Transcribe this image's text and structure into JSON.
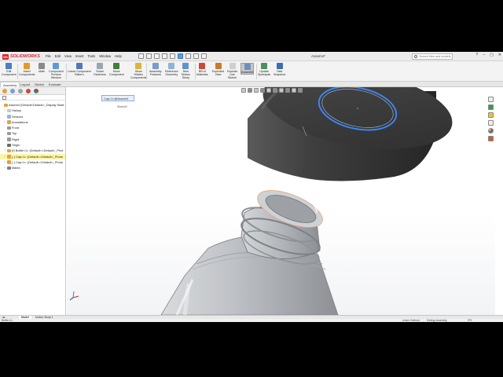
{
  "app": {
    "brand": "SOLIDWORKS",
    "menus": [
      "File",
      "Edit",
      "View",
      "Insert",
      "Tools",
      "Window",
      "Help"
    ],
    "document_title": "Assem4*",
    "search_placeholder": "Search files and models",
    "window_controls": [
      "?",
      "–",
      "▢",
      "✕"
    ]
  },
  "commands": [
    {
      "id": "edit-component",
      "label": "Edit\nComponent",
      "color": "#4a7fc1"
    },
    {
      "id": "insert-components",
      "label": "Insert\nComponents",
      "color": "#e39a2e"
    },
    {
      "id": "mate",
      "label": "Mate",
      "color": "#8a8a8a"
    },
    {
      "id": "component-preview",
      "label": "Component\nPreview\nWindow",
      "color": "#5e9bd6"
    },
    {
      "id": "linear-pattern",
      "label": "Linear Component\nPattern",
      "color": "#5179b8"
    },
    {
      "id": "smart-fasteners",
      "label": "Smart\nFasteners",
      "color": "#9aa6b1"
    },
    {
      "id": "move-component",
      "label": "Move\nComponent",
      "color": "#3f7f3f"
    },
    {
      "id": "show-hidden",
      "label": "Show\nHidden\nComponents",
      "color": "#d9b53a"
    },
    {
      "id": "assembly-features",
      "label": "Assembly\nFeatures",
      "color": "#7a9ac7"
    },
    {
      "id": "reference-geometry",
      "label": "Reference\nGeometry",
      "color": "#8fb3d9"
    },
    {
      "id": "new-motion-study",
      "label": "New\nMotion\nStudy",
      "color": "#5f95c9"
    },
    {
      "id": "bill-of-materials",
      "label": "Bill of\nMaterials",
      "color": "#c94a3a"
    },
    {
      "id": "exploded-view",
      "label": "Exploded\nView",
      "color": "#c97a2a"
    },
    {
      "id": "explode-line-sketch",
      "label": "Explode\nLine\nSketch",
      "color": "#cfcfcf"
    },
    {
      "id": "instant3d",
      "label": "Instant3D",
      "color": "#6d8fbf"
    },
    {
      "id": "update-speedpak",
      "label": "Update\nSpeedpak",
      "color": "#4c8f5c"
    },
    {
      "id": "take-snapshot",
      "label": "Take\nSnapshot",
      "color": "#3b6fb1"
    }
  ],
  "command_tabs": [
    "Assembly",
    "Layout",
    "Sketch",
    "Evaluate"
  ],
  "tree": [
    {
      "label": "Assem4  (Default<Default>_Display State 1>)",
      "level": 0,
      "icon": "#e5a23b",
      "twisty": ""
    },
    {
      "label": "History",
      "level": 1,
      "icon": "#c7c7c7",
      "twisty": ">"
    },
    {
      "label": "Sensors",
      "level": 1,
      "icon": "#8fb7df",
      "twisty": ""
    },
    {
      "label": "Annotations",
      "level": 1,
      "icon": "#e0a43c",
      "twisty": ">"
    },
    {
      "label": "Front",
      "level": 1,
      "icon": "#9a9a9a",
      "twisty": ""
    },
    {
      "label": "Top",
      "level": 1,
      "icon": "#9a9a9a",
      "twisty": ""
    },
    {
      "label": "Right",
      "level": 1,
      "icon": "#9a9a9a",
      "twisty": ""
    },
    {
      "label": "Origin",
      "level": 1,
      "icon": "#6b6b6b",
      "twisty": ""
    },
    {
      "label": "(f) Bottle<1> (Default<<Default>_Phot",
      "level": 1,
      "icon": "#e5a23b",
      "twisty": ">"
    },
    {
      "label": "(-) Cap<1> (Default<<Default>_Photo",
      "level": 1,
      "icon": "#e5a23b",
      "twisty": ">",
      "highlight": true
    },
    {
      "label": "(-) Cap<1> (Default<<Default>_Photo",
      "level": 1,
      "icon": "#e5a23b",
      "twisty": ">"
    },
    {
      "label": "Mates",
      "level": 1,
      "icon": "#7f7f7f",
      "twisty": ">"
    }
  ],
  "graphics": {
    "breadcrumb_item": "Cap<1>@Assem4",
    "breadcrumb_sketch": "Sketch2"
  },
  "bottom_tabs": [
    "Model",
    "Motion Study 1"
  ],
  "status": {
    "left": "Bottle<1>",
    "state": "Under Defined",
    "mode": "Editing Assembly",
    "units": "IPS"
  },
  "colors": {
    "cap": "#3c3c3c",
    "bottle": "#b9bcc0",
    "sketch_highlight": "#3b8bff"
  }
}
